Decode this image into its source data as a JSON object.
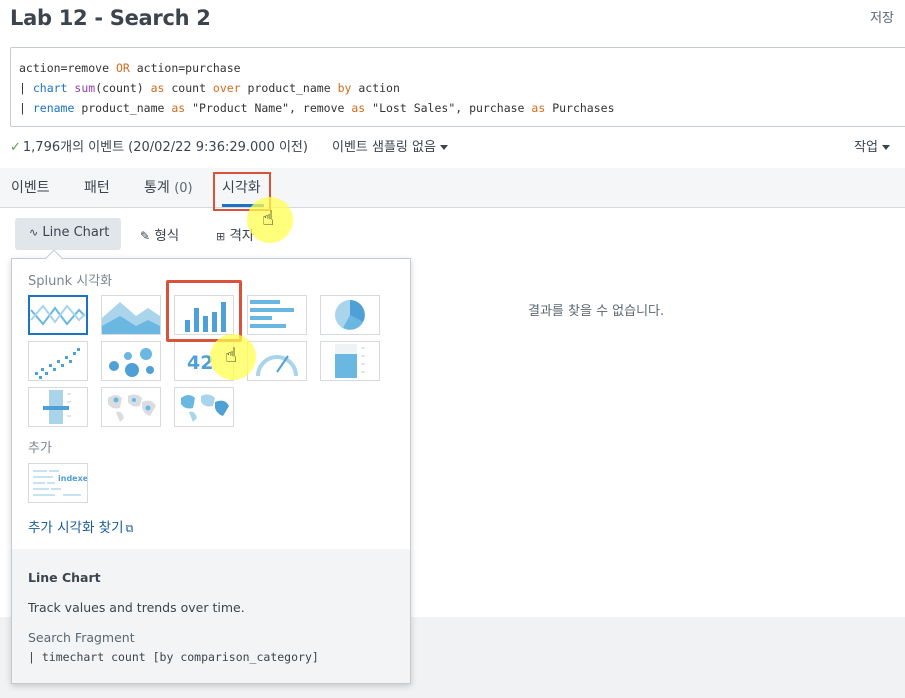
{
  "header": {
    "title": "Lab 12 - Search 2",
    "save_label": "저장"
  },
  "query": {
    "line1": {
      "a": "action=remove ",
      "b": "OR",
      "c": " action=purchase"
    },
    "line2": {
      "pipe": "| ",
      "chart": "chart",
      "sp1": " ",
      "sum": "sum",
      "args": "(count) ",
      "as1": "as",
      "mid": " count ",
      "over": "over",
      "prod": " product_name ",
      "by": "by",
      "end": " action"
    },
    "line3": {
      "pipe": "| ",
      "rename": "rename",
      "p1": " product_name ",
      "as1": "as",
      "p2": " \"Product Name\", remove ",
      "as2": "as",
      "p3": " \"Lost Sales\", purchase ",
      "as3": "as",
      "p4": " Purchases"
    }
  },
  "status": {
    "events": "1,796개의 이벤트 (20/02/22 9:36:29.000 이전)",
    "sampling": "이벤트 샘플링 없음",
    "job": "작업"
  },
  "tabs": {
    "events": "이벤트",
    "patterns": "패턴",
    "statistics": "통계",
    "statistics_count": "(0)",
    "visualization": "시각화"
  },
  "viz_toolbar": {
    "chart_type": "Line Chart",
    "format": "형식",
    "trellis": "격자"
  },
  "no_results": "결과를 찾을 수 없습니다.",
  "picker": {
    "splunk_label": "Splunk 시각화",
    "more_label": "추가",
    "find_more": "추가 시각화 찾기",
    "thumbnails": [
      "line-chart",
      "area-chart",
      "column-chart",
      "bar-chart",
      "pie-chart",
      "scatter-chart",
      "bubble-chart",
      "single-value",
      "radial-gauge",
      "filler-gauge",
      "marker-gauge",
      "cluster-map",
      "choropleth-map",
      "indexer-viz"
    ],
    "single_value_text": "42",
    "indexer_text": "indexer",
    "selected": "Line Chart",
    "description": "Track values and trends over time.",
    "fragment_label": "Search Fragment",
    "fragment_code": "| timechart count [by comparison_category]"
  },
  "colors": {
    "accent": "#1a73c7",
    "highlight": "#d9533b",
    "viz": "#6ab7e1"
  }
}
